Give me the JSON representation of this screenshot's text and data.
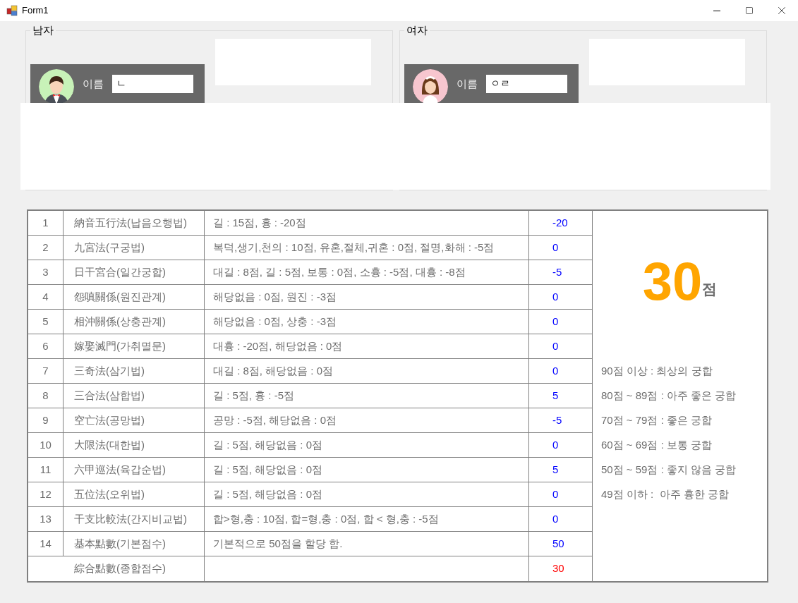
{
  "window": {
    "title": "Form1"
  },
  "profiles": [
    {
      "kind": "male",
      "group": "남자",
      "name_label": "이름",
      "name_value": "ㄴ"
    },
    {
      "kind": "female",
      "group": "여자",
      "name_label": "이름",
      "name_value": "ㅇㄹ"
    }
  ],
  "table": {
    "rows": [
      {
        "kind": "item",
        "number": "1",
        "method": "納音五行法(납음오행법)",
        "rule": "길 : 15점, 흉 : -20점",
        "score": "-20"
      },
      {
        "kind": "item",
        "number": "2",
        "method": "九宮法(구궁법)",
        "rule": "복덕,생기,천의 : 10점, 유혼,절체,귀혼 : 0점, 절명,화해 : -5점",
        "score": "0"
      },
      {
        "kind": "item",
        "number": "3",
        "method": "日干宮合(일간궁합)",
        "rule": "대길 : 8점, 길 : 5점, 보통 : 0점, 소흉 : -5점, 대흉 : -8점",
        "score": "-5"
      },
      {
        "kind": "item",
        "number": "4",
        "method": "怨嗔關係(원진관계)",
        "rule": "해당없음 : 0점, 원진 : -3점",
        "score": "0"
      },
      {
        "kind": "item",
        "number": "5",
        "method": "相沖關係(상충관계)",
        "rule": "해당없음 : 0점, 상충 : -3점",
        "score": "0"
      },
      {
        "kind": "item",
        "number": "6",
        "method": "嫁娶滅門(가취멸문)",
        "rule": "대흉 : -20점, 해당없음 : 0점",
        "score": "0"
      },
      {
        "kind": "item",
        "number": "7",
        "method": "三奇法(삼기법)",
        "rule": "대길 : 8점, 해당없음 : 0점",
        "score": "0"
      },
      {
        "kind": "item",
        "number": "8",
        "method": "三合法(삼합법)",
        "rule": "길 : 5점, 흉 : -5점",
        "score": "5"
      },
      {
        "kind": "item",
        "number": "9",
        "method": "空亡法(공망법)",
        "rule": "공망 : -5점, 해당없음 : 0점",
        "score": "-5"
      },
      {
        "kind": "item",
        "number": "10",
        "method": "大限法(대한법)",
        "rule": "길 : 5점, 해당없음 : 0점",
        "score": "0"
      },
      {
        "kind": "item",
        "number": "11",
        "method": "六甲巡法(육갑순법)",
        "rule": "길 : 5점, 해당없음 : 0점",
        "score": "5"
      },
      {
        "kind": "item",
        "number": "12",
        "method": "五位法(오위법)",
        "rule": "길 : 5점, 해당없음 : 0점",
        "score": "0"
      },
      {
        "kind": "item",
        "number": "13",
        "method": "干支比較法(간지비교법)",
        "rule": "합>형,충 : 10점, 합=형,충 : 0점, 합 < 형,충 : -5점",
        "score": "0"
      },
      {
        "kind": "item",
        "number": "14",
        "method": "基本點數(기본점수)",
        "rule": "기본적으로 50점을 할당 함.",
        "score": "50"
      },
      {
        "kind": "total",
        "method": "綜合點數(종합점수)",
        "score": "30"
      }
    ]
  },
  "summary": {
    "score": "30",
    "unit": "점",
    "legend": [
      "90점 이상 : 최상의 궁합",
      "80점 ~ 89점 : 아주 좋은 궁합",
      "70점 ~ 79점 : 좋은 궁합",
      "60점 ~ 69점 : 보통 궁합",
      "50점 ~ 59점 : 좋지 않음 궁합",
      "49점 이하 :  아주 흉한 궁합"
    ]
  }
}
